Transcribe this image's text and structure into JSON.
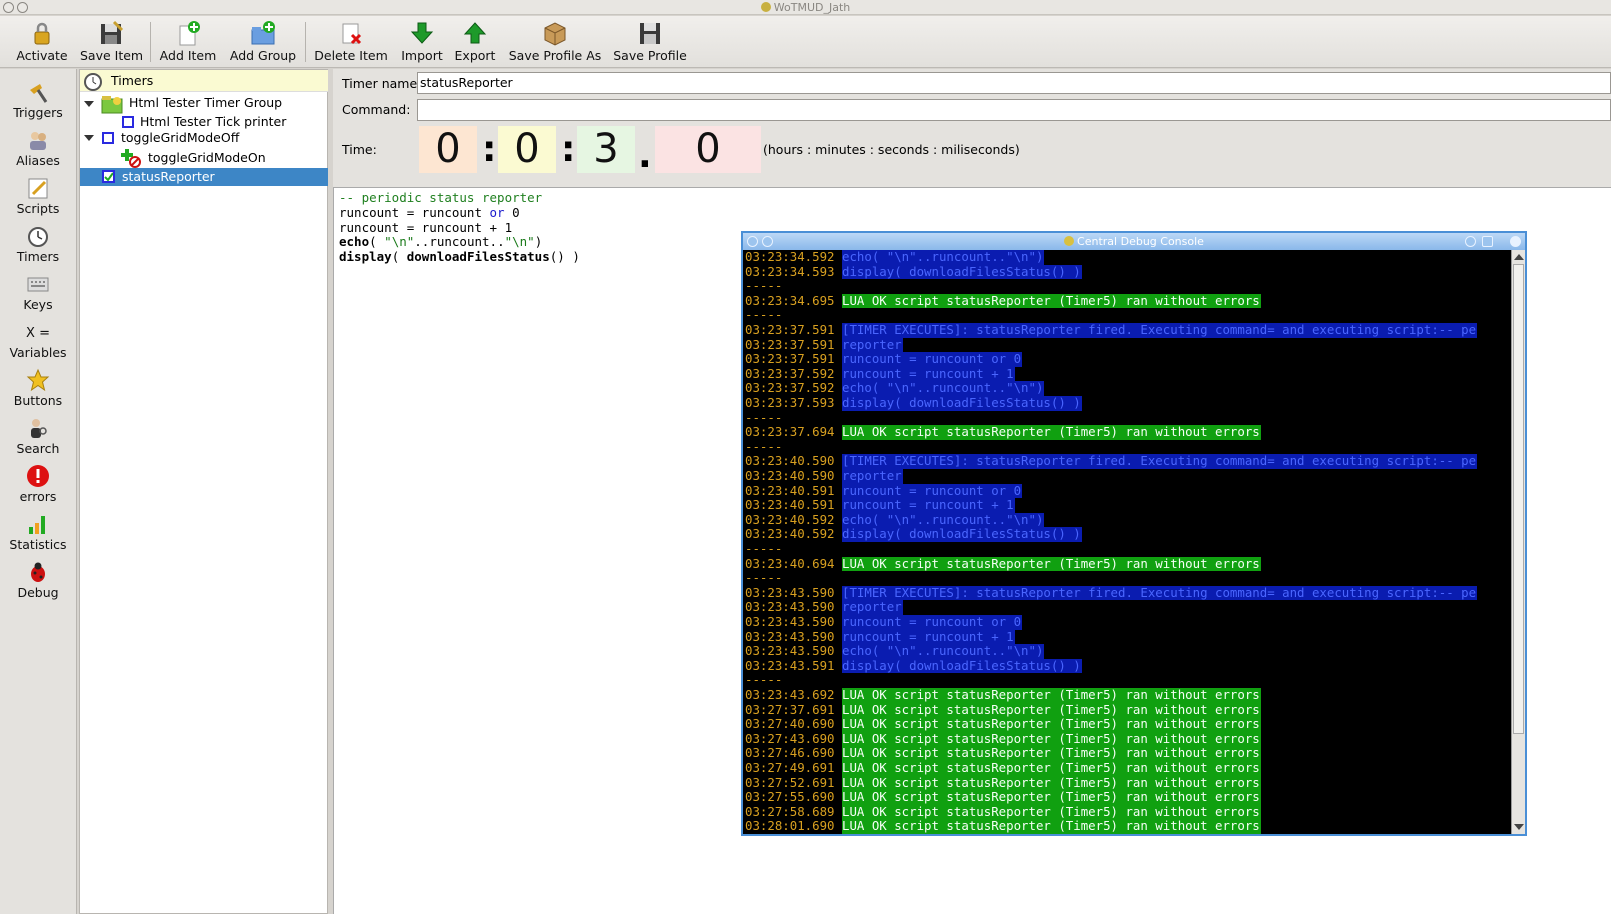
{
  "window": {
    "title": "WoTMUD_Jath"
  },
  "toolbar": {
    "activate": "Activate",
    "save_item": "Save Item",
    "add_item": "Add Item",
    "add_group": "Add Group",
    "delete_item": "Delete Item",
    "import": "Import",
    "export": "Export",
    "save_profile_as": "Save Profile As",
    "save_profile": "Save Profile"
  },
  "sidebar": {
    "triggers": "Triggers",
    "aliases": "Aliases",
    "scripts": "Scripts",
    "timers": "Timers",
    "keys": "Keys",
    "variables_glyph": "X =",
    "variables": "Variables",
    "buttons": "Buttons",
    "search": "Search",
    "errors": "errors",
    "statistics": "Statistics",
    "debug": "Debug"
  },
  "tree": {
    "root": "Timers",
    "nodes": [
      "Html Tester Timer Group",
      "Html Tester Tick printer",
      "toggleGridModeOff",
      "toggleGridModeOn",
      "statusReporter"
    ]
  },
  "form": {
    "timer_name_label": "Timer name:",
    "timer_name_value": "statusReporter",
    "command_label": "Command:",
    "command_value": "",
    "time_label": "Time:",
    "hours": "0",
    "minutes": "0",
    "seconds": "3",
    "milliseconds": "0",
    "time_hint": "(hours : minutes : seconds : miliseconds)"
  },
  "script": {
    "line1": "-- periodic status reporter",
    "line2": "runcount = runcount ",
    "line2_kw": "or",
    "line2_end": " 0",
    "line3": "runcount = runcount + 1",
    "line4_fn": "echo",
    "line4_a": "( ",
    "line4_s1": "\"\\n\"",
    "line4_b": "..runcount..",
    "line4_s2": "\"\\n\"",
    "line4_c": ")",
    "line5_fn": "display",
    "line5_a": "( ",
    "line5_fn2": "downloadFilesStatus",
    "line5_b": "() )"
  },
  "console": {
    "title": "Central Debug Console",
    "lines": [
      [
        "03:23:34.592",
        "echo( \"\\n\"..runcount..\"\\n\")",
        "blue"
      ],
      [
        "03:23:34.593",
        "display( downloadFilesStatus() )",
        "blue"
      ],
      [
        "-----",
        "",
        "sep"
      ],
      [
        "03:23:34.695",
        "LUA OK script statusReporter (Timer5) ran without errors",
        "green"
      ],
      [
        "-----",
        "",
        "sep"
      ],
      [
        "03:23:37.591",
        "[TIMER EXECUTES]: statusReporter fired. Executing command= and executing script:-- pe",
        "blue"
      ],
      [
        "03:23:37.591",
        "reporter",
        "blue"
      ],
      [
        "03:23:37.591",
        "runcount = runcount or 0",
        "blue"
      ],
      [
        "03:23:37.592",
        "runcount = runcount + 1",
        "blue"
      ],
      [
        "03:23:37.592",
        "echo( \"\\n\"..runcount..\"\\n\")",
        "blue"
      ],
      [
        "03:23:37.593",
        "display( downloadFilesStatus() )",
        "blue"
      ],
      [
        "-----",
        "",
        "sep"
      ],
      [
        "03:23:37.694",
        "LUA OK script statusReporter (Timer5) ran without errors",
        "green"
      ],
      [
        "-----",
        "",
        "sep"
      ],
      [
        "03:23:40.590",
        "[TIMER EXECUTES]: statusReporter fired. Executing command= and executing script:-- pe",
        "blue"
      ],
      [
        "03:23:40.590",
        "reporter",
        "blue"
      ],
      [
        "03:23:40.591",
        "runcount = runcount or 0",
        "blue"
      ],
      [
        "03:23:40.591",
        "runcount = runcount + 1",
        "blue"
      ],
      [
        "03:23:40.592",
        "echo( \"\\n\"..runcount..\"\\n\")",
        "blue"
      ],
      [
        "03:23:40.592",
        "display( downloadFilesStatus() )",
        "blue"
      ],
      [
        "-----",
        "",
        "sep"
      ],
      [
        "03:23:40.694",
        "LUA OK script statusReporter (Timer5) ran without errors",
        "green"
      ],
      [
        "-----",
        "",
        "sep"
      ],
      [
        "03:23:43.590",
        "[TIMER EXECUTES]: statusReporter fired. Executing command= and executing script:-- pe",
        "blue"
      ],
      [
        "03:23:43.590",
        "reporter",
        "blue"
      ],
      [
        "03:23:43.590",
        "runcount = runcount or 0",
        "blue"
      ],
      [
        "03:23:43.590",
        "runcount = runcount + 1",
        "blue"
      ],
      [
        "03:23:43.590",
        "echo( \"\\n\"..runcount..\"\\n\")",
        "blue"
      ],
      [
        "03:23:43.591",
        "display( downloadFilesStatus() )",
        "blue"
      ],
      [
        "-----",
        "",
        "sep"
      ],
      [
        "03:23:43.692",
        "LUA OK script statusReporter (Timer5) ran without errors",
        "green"
      ],
      [
        "03:27:37.691",
        "LUA OK script statusReporter (Timer5) ran without errors",
        "green"
      ],
      [
        "03:27:40.690",
        "LUA OK script statusReporter (Timer5) ran without errors",
        "green"
      ],
      [
        "03:27:43.690",
        "LUA OK script statusReporter (Timer5) ran without errors",
        "green"
      ],
      [
        "03:27:46.690",
        "LUA OK script statusReporter (Timer5) ran without errors",
        "green"
      ],
      [
        "03:27:49.691",
        "LUA OK script statusReporter (Timer5) ran without errors",
        "green"
      ],
      [
        "03:27:52.691",
        "LUA OK script statusReporter (Timer5) ran without errors",
        "green"
      ],
      [
        "03:27:55.690",
        "LUA OK script statusReporter (Timer5) ran without errors",
        "green"
      ],
      [
        "03:27:58.689",
        "LUA OK script statusReporter (Timer5) ran without errors",
        "green"
      ],
      [
        "03:28:01.690",
        "LUA OK script statusReporter (Timer5) ran without errors",
        "green"
      ]
    ]
  },
  "colors": {
    "accent_selection": "#3d86c6",
    "console_blue_bg": "#0a1cb0",
    "console_green_bg": "#10a010",
    "timestamp": "#d8a020"
  }
}
